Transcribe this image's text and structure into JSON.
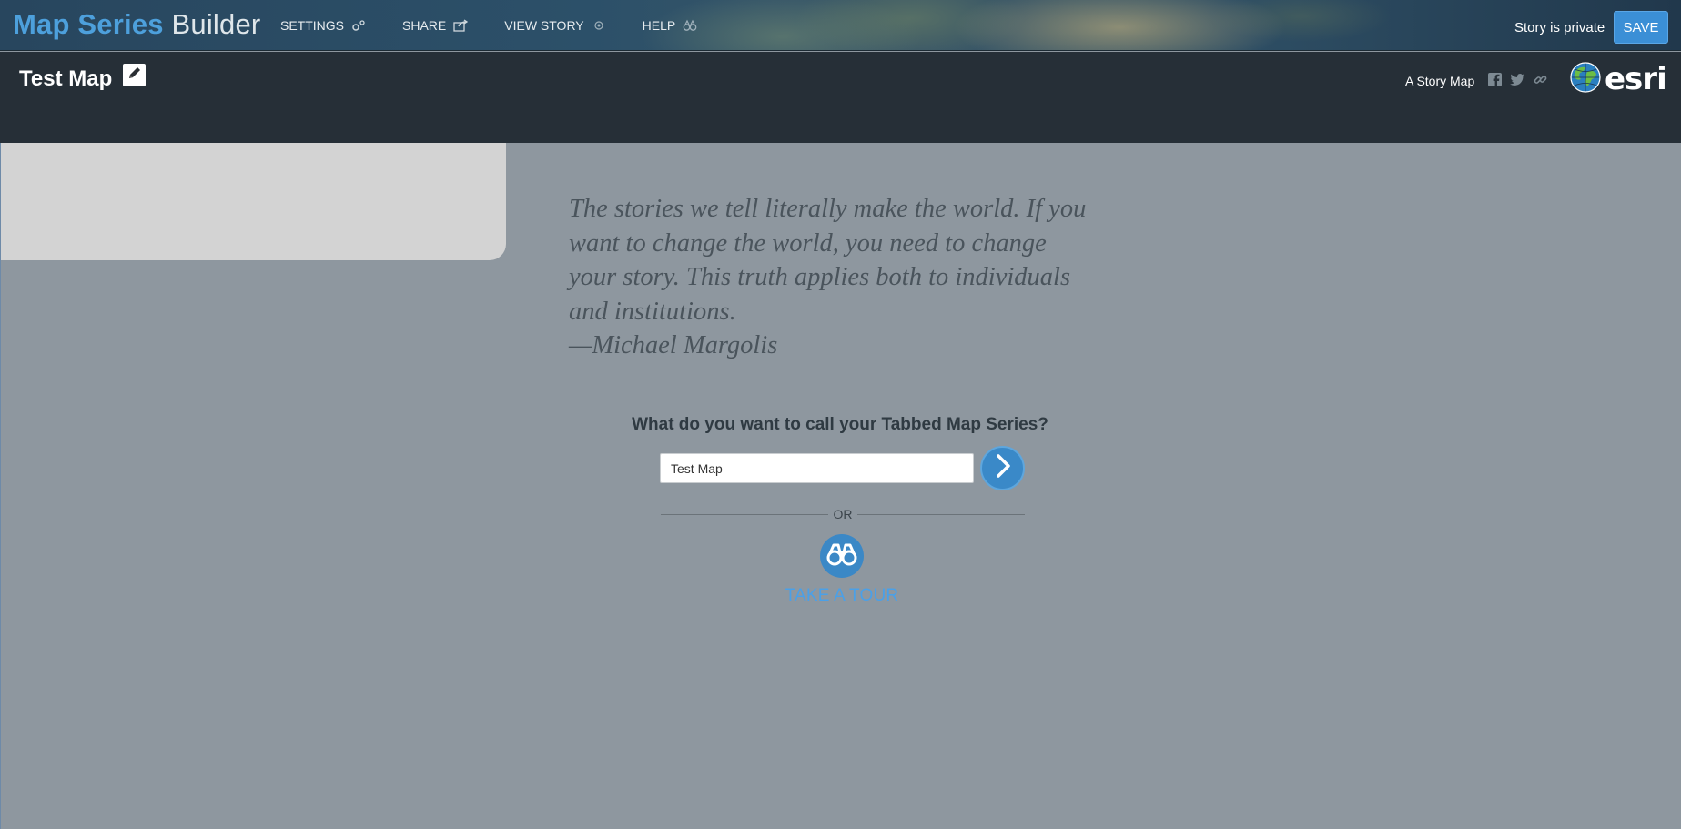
{
  "app": {
    "title_strong": "Map Series",
    "title_light": "Builder"
  },
  "nav": {
    "settings": "SETTINGS",
    "share": "SHARE",
    "view_story": "VIEW STORY",
    "help": "HELP"
  },
  "status": {
    "private_label": "Story is private",
    "save_label": "SAVE"
  },
  "header": {
    "story_title": "Test Map",
    "story_map_label": "A Story Map",
    "social_icons": [
      "facebook-icon",
      "twitter-icon",
      "link-icon"
    ],
    "logo_text": "esri"
  },
  "main": {
    "quote_lines": [
      "The stories we tell literally make the world. If you",
      "want to change the world, you need to change",
      "your story. This truth applies both to individuals",
      "and institutions."
    ],
    "quote_author": "—Michael Margolis",
    "prompt": "What do you want to call your Tabbed Map Series?",
    "title_input_value": "Test Map",
    "or_label": "OR",
    "tour_label": "TAKE A TOUR"
  },
  "colors": {
    "accent": "#3b8fd6",
    "title_blue": "#4da0dc",
    "header_bg": "#262f37",
    "main_bg": "#8e979f",
    "panel_bg": "#d3d3d3",
    "tour_link": "#4aa0e8"
  }
}
